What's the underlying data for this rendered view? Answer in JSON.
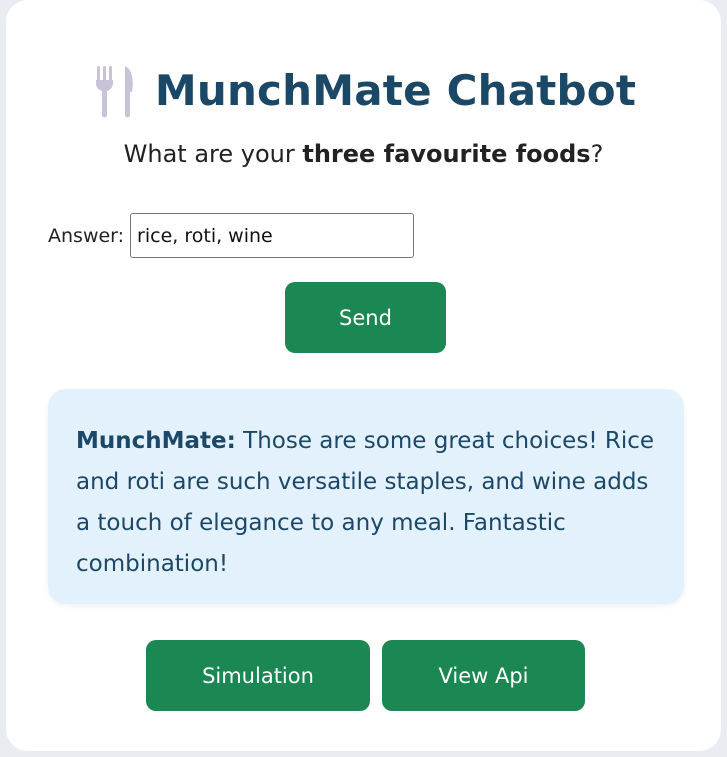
{
  "header": {
    "icon": "fork-and-knife-icon",
    "title": "MunchMate Chatbot"
  },
  "question": {
    "prefix": "What are your ",
    "emphasis": "three favourite foods",
    "suffix": "?"
  },
  "answer": {
    "label": "Answer:",
    "value": "rice, roti, wine"
  },
  "send": {
    "label": "Send"
  },
  "response": {
    "speaker": "MunchMate:",
    "message": "Those are some great choices! Rice and roti are such versatile staples, and wine adds a touch of elegance to any meal. Fantastic combination!"
  },
  "footer": {
    "simulation_label": "Simulation",
    "api_label": "View Api"
  },
  "colors": {
    "title": "#1b4866",
    "button": "#1b8753",
    "response_bg": "#e3f1fc"
  }
}
